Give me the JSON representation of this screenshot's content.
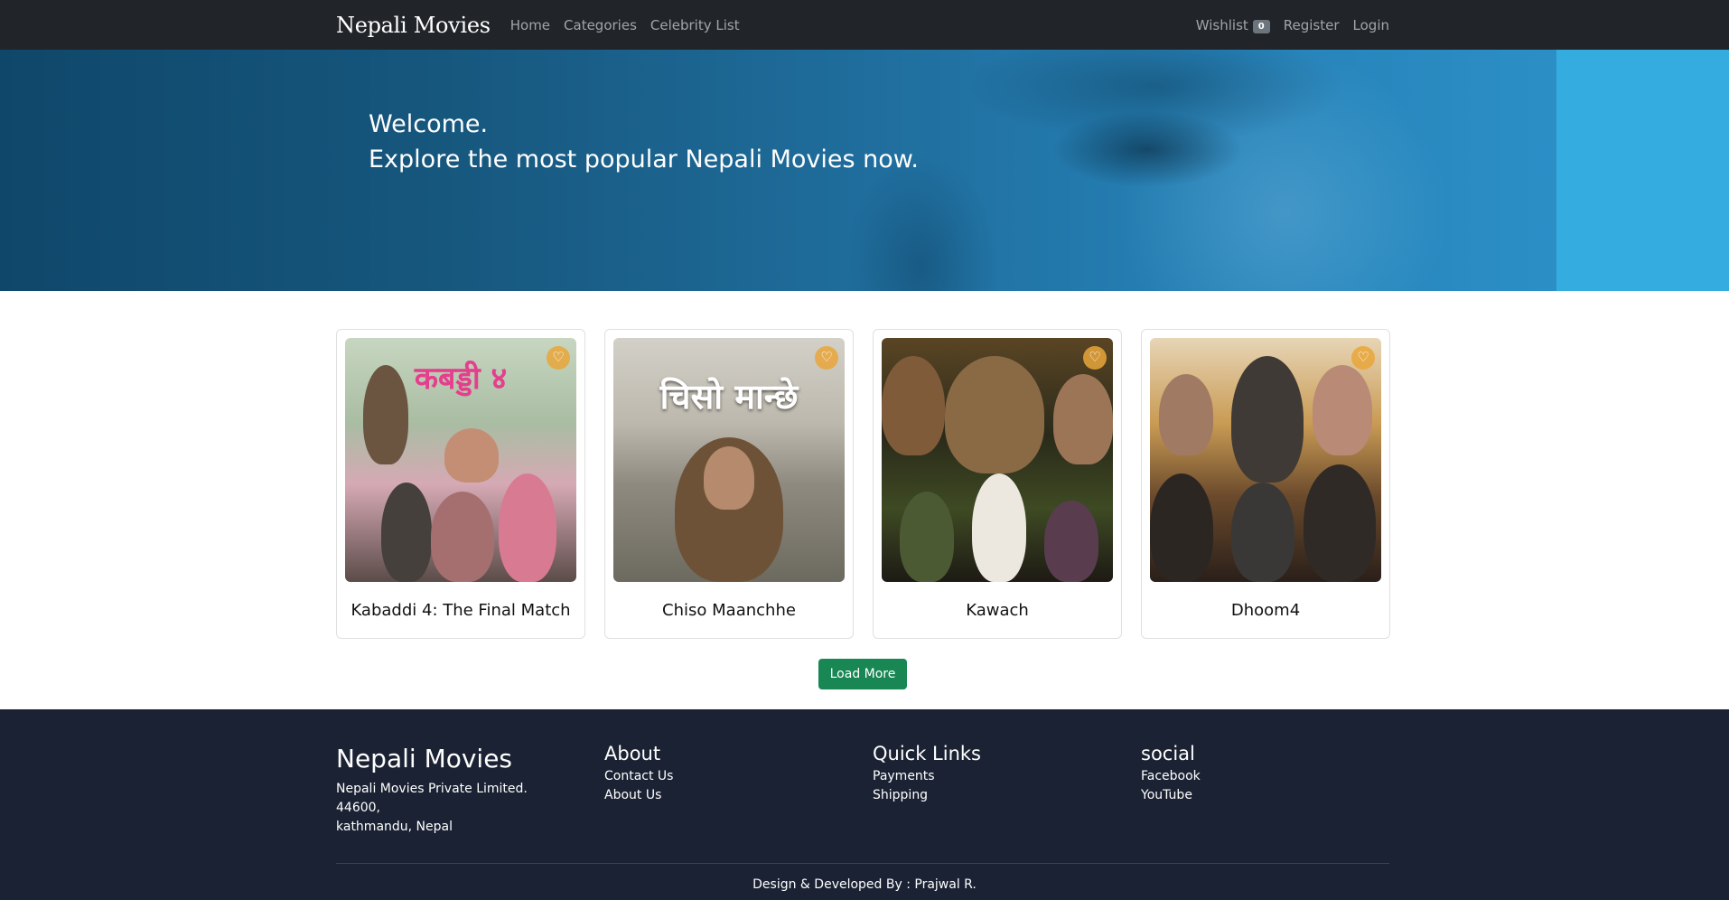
{
  "navbar": {
    "brand": "Nepali Movies",
    "links": [
      "Home",
      "Categories",
      "Celebrity List"
    ],
    "wishlist_label": "Wishlist",
    "wishlist_count": "0",
    "register": "Register",
    "login": "Login"
  },
  "hero": {
    "line1": "Welcome.",
    "line2": "Explore the most popular Nepali Movies now."
  },
  "movies": [
    {
      "title": "Kabaddi 4: The Final Match",
      "poster_text": "कबड्डी ४"
    },
    {
      "title": "Chiso Maanchhe",
      "poster_text": "चिसो मान्छे"
    },
    {
      "title": "Kawach"
    },
    {
      "title": "Dhoom4"
    }
  ],
  "load_more": "Load More",
  "footer": {
    "brand": "Nepali Movies",
    "address": [
      "Nepali Movies Private Limited.",
      "44600,",
      "kathmandu, Nepal"
    ],
    "about_heading": "About",
    "about_links": [
      "Contact Us",
      "About Us"
    ],
    "quick_heading": "Quick Links",
    "quick_links": [
      "Payments",
      "Shipping"
    ],
    "social_heading": "social",
    "social_links": [
      "Facebook",
      "YouTube"
    ],
    "credit": "Design & Developed By : Prajwal R."
  },
  "colors": {
    "navbar_bg": "#212529",
    "hero_blue": "#35ace0",
    "button_green": "#198754",
    "footer_bg": "#1a2233",
    "heart_accent": "#e9a63a"
  },
  "icons": {
    "wishlist_heart": "heart-icon"
  }
}
